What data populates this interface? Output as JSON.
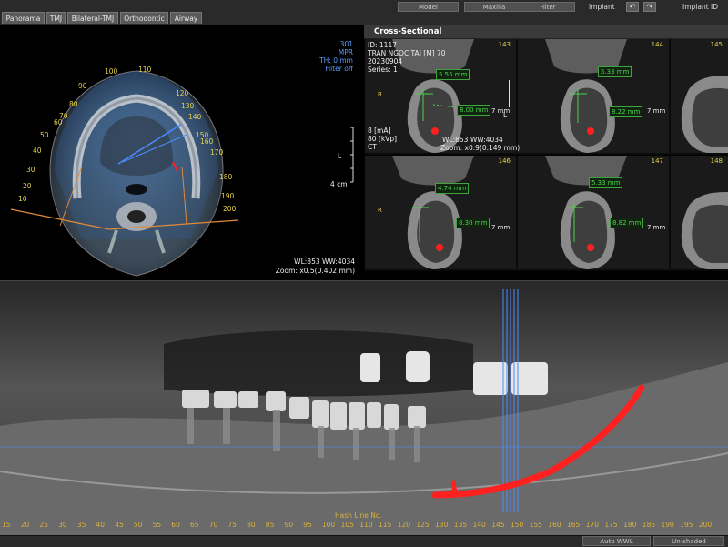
{
  "tabs": [
    "Panorama",
    "TMJ",
    "Bilateral-TMJ",
    "Orthodontic",
    "Airway"
  ],
  "toolbar": {
    "model": "Model",
    "maxilla": "Maxilla",
    "filter": "Filter",
    "implant_label": "Implant",
    "implant_id_label": "Implant ID"
  },
  "axial": {
    "info_lines": [
      "301",
      "MPR",
      "TH: 0 mm",
      "Filter off"
    ],
    "scale_label": "4 cm",
    "l_label": "L",
    "wl_ww": "WL:853 WW:4034",
    "zoom": "Zoom: x0.5(0.402 mm)",
    "arch_numbers": [
      "10",
      "20",
      "30",
      "40",
      "50",
      "60",
      "70",
      "80",
      "90",
      "100",
      "110",
      "120",
      "130",
      "140",
      "150",
      "160",
      "170",
      "180",
      "190",
      "200"
    ]
  },
  "cross": {
    "title": "Cross-Sectional",
    "info_lines": [
      "ID: 1117",
      "TRAN NGOC TAI [M] 70",
      "20230904",
      "Series: 1"
    ],
    "exposure_lines": [
      "8 [mA]",
      "80 [kVp]",
      "CT"
    ],
    "wl_ww": "WL:853 WW:4034",
    "zoom": "Zoom: x0.9(0.149 mm)",
    "r_label": "R",
    "l_label": "L",
    "scale": "7 mm",
    "cells": [
      {
        "num": "143",
        "m1": "5.55 mm",
        "m2": "8.00 mm"
      },
      {
        "num": "144",
        "m1": "5.33 mm",
        "m2": "8.22 mm"
      },
      {
        "num": "145",
        "m1": "",
        "m2": ""
      },
      {
        "num": "146",
        "m1": "4.74 mm",
        "m2": "8.30 mm"
      },
      {
        "num": "147",
        "m1": "5.33 mm",
        "m2": "8.82 mm"
      },
      {
        "num": "148",
        "m1": "",
        "m2": ""
      }
    ]
  },
  "panorama": {
    "hash_label": "Hash Line No.",
    "ticks": [
      "15",
      "20",
      "25",
      "30",
      "35",
      "40",
      "45",
      "50",
      "55",
      "60",
      "65",
      "70",
      "75",
      "80",
      "85",
      "90",
      "95",
      "100",
      "105",
      "110",
      "115",
      "120",
      "125",
      "130",
      "135",
      "140",
      "145",
      "150",
      "155",
      "160",
      "165",
      "170",
      "175",
      "180",
      "185",
      "190",
      "195",
      "200"
    ]
  },
  "bottom": {
    "auto_wwl": "Auto WWL",
    "unshaded": "Un-shaded"
  },
  "colors": {
    "nerve_canal": "#ff2020",
    "measure": "#4cd24c",
    "accent_blue": "#4a8cff",
    "tick_yellow": "#d9b13a"
  }
}
